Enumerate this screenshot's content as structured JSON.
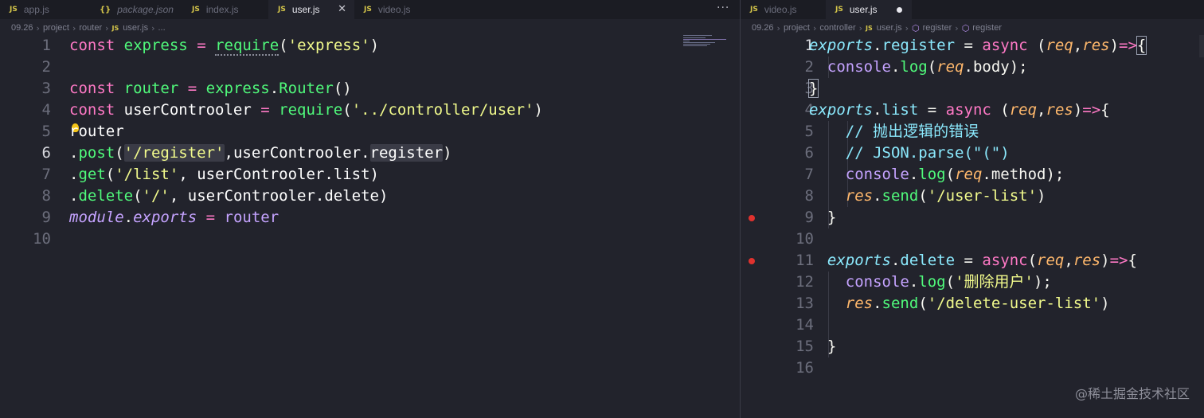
{
  "left_pane": {
    "tabs": [
      {
        "label": "app.js",
        "icon": "js-file-icon"
      },
      {
        "label": "package.json",
        "icon": "json-file-icon"
      },
      {
        "label": "index.js",
        "icon": "js-file-icon"
      },
      {
        "label": "user.js",
        "icon": "js-file-icon",
        "active": true
      },
      {
        "label": "video.js",
        "icon": "js-file-icon"
      }
    ],
    "more_label": "···",
    "breadcrumb": [
      "09.26",
      "project",
      "router",
      "user.js",
      "..."
    ],
    "line_numbers": [
      "1",
      "2",
      "3",
      "4",
      "5",
      "6",
      "7",
      "8",
      "9",
      "10"
    ],
    "code": {
      "l1": [
        "const",
        "express",
        "=",
        "require",
        "(",
        "'express'",
        ")"
      ],
      "l3": [
        "const",
        "router",
        "=",
        "express",
        ".",
        "Router",
        "()"
      ],
      "l4": [
        "const",
        "userControoler",
        "=",
        "require",
        "(",
        "'../controller/user'",
        ")"
      ],
      "l5": [
        "router"
      ],
      "l6": [
        ".",
        "post",
        "(",
        "'/register'",
        ",userControoler.",
        "register",
        ")"
      ],
      "l7": [
        ".",
        "get",
        "(",
        "'/list'",
        ", userControoler.list)"
      ],
      "l8": [
        ".",
        "delete",
        "(",
        "'/'",
        ", userControoler.delete)"
      ],
      "l9": [
        "module",
        ".",
        "exports",
        "=",
        "router"
      ]
    }
  },
  "right_pane": {
    "tabs": [
      {
        "label": "video.js",
        "icon": "js-file-icon"
      },
      {
        "label": "user.js",
        "icon": "js-file-icon",
        "active": true,
        "dirty": true
      }
    ],
    "breadcrumb": [
      "09.26",
      "project",
      "controller",
      "user.js",
      "register",
      "register"
    ],
    "line_numbers": [
      "1",
      "2",
      "3",
      "4",
      "5",
      "6",
      "7",
      "8",
      "9",
      "10",
      "11",
      "12",
      "13",
      "14",
      "15",
      "16"
    ],
    "code": {
      "l1": [
        "exports",
        ".",
        "register",
        " = ",
        "async",
        " (",
        "req",
        ",",
        "res",
        ")",
        "=>",
        "{"
      ],
      "l2": [
        "console",
        ".",
        "log",
        "(",
        "req",
        ".body);"
      ],
      "l3": [
        "}"
      ],
      "l4": [
        "exports",
        ".",
        "list",
        " = ",
        "async",
        " (",
        "req",
        ",",
        "res",
        ")",
        "=>",
        "{"
      ],
      "l5": [
        "// 抛出逻辑的错误"
      ],
      "l6": [
        "// JSON.parse(\"(\")"
      ],
      "l7": [
        "console",
        ".",
        "log",
        "(",
        "req",
        ".method);"
      ],
      "l8": [
        "res",
        ".",
        "send",
        "(",
        "'/user-list'",
        ")"
      ],
      "l9": [
        "}"
      ],
      "l11": [
        "exports",
        ".",
        "delete",
        " = ",
        "async",
        "(",
        "req",
        ",",
        "res",
        ")",
        "=>",
        "{"
      ],
      "l12": [
        "console",
        ".",
        "log",
        "(",
        "'删除用户'",
        ");"
      ],
      "l13": [
        "res",
        ".",
        "send",
        "(",
        "'/delete-user-list'",
        ")"
      ],
      "l15": [
        "}"
      ]
    },
    "breakpoint_lines": [
      9,
      11
    ]
  },
  "watermark": "@稀土掘金技术社区"
}
